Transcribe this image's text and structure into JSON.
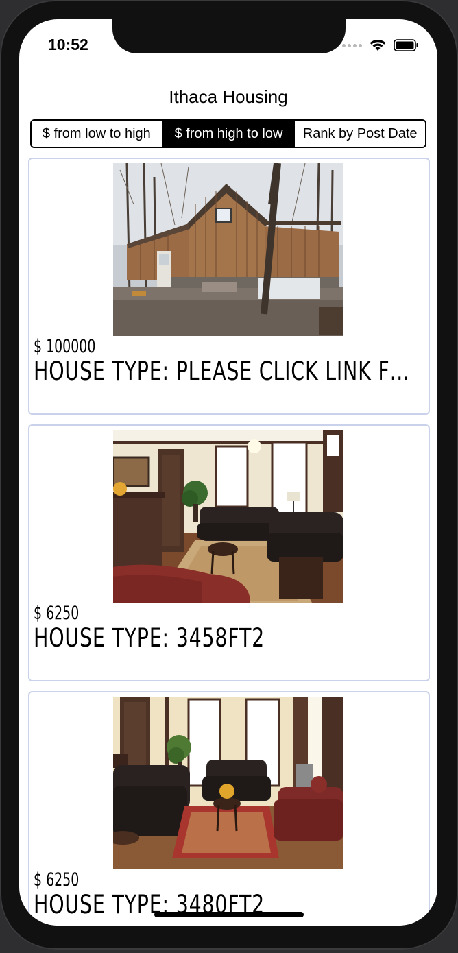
{
  "status_bar": {
    "time": "10:52"
  },
  "nav": {
    "title": "Ithaca Housing"
  },
  "sort_control": {
    "options": [
      "$ from low to high",
      "$ from high to low",
      "Rank by Post Date"
    ],
    "selected_index": 1
  },
  "listings": [
    {
      "price": "$ 100000",
      "house_type": "House Type: please click link for the details",
      "photo": "cabin-exterior"
    },
    {
      "price": "$ 6250",
      "house_type": "House Type: 3458ft2",
      "photo": "living-room"
    },
    {
      "price": "$ 6250",
      "house_type": "House Type: 3480ft2",
      "photo": "living-room"
    }
  ],
  "colors": {
    "card_border": "#c9d2ea",
    "segment_active": "#000000",
    "background": "#ffffff"
  }
}
